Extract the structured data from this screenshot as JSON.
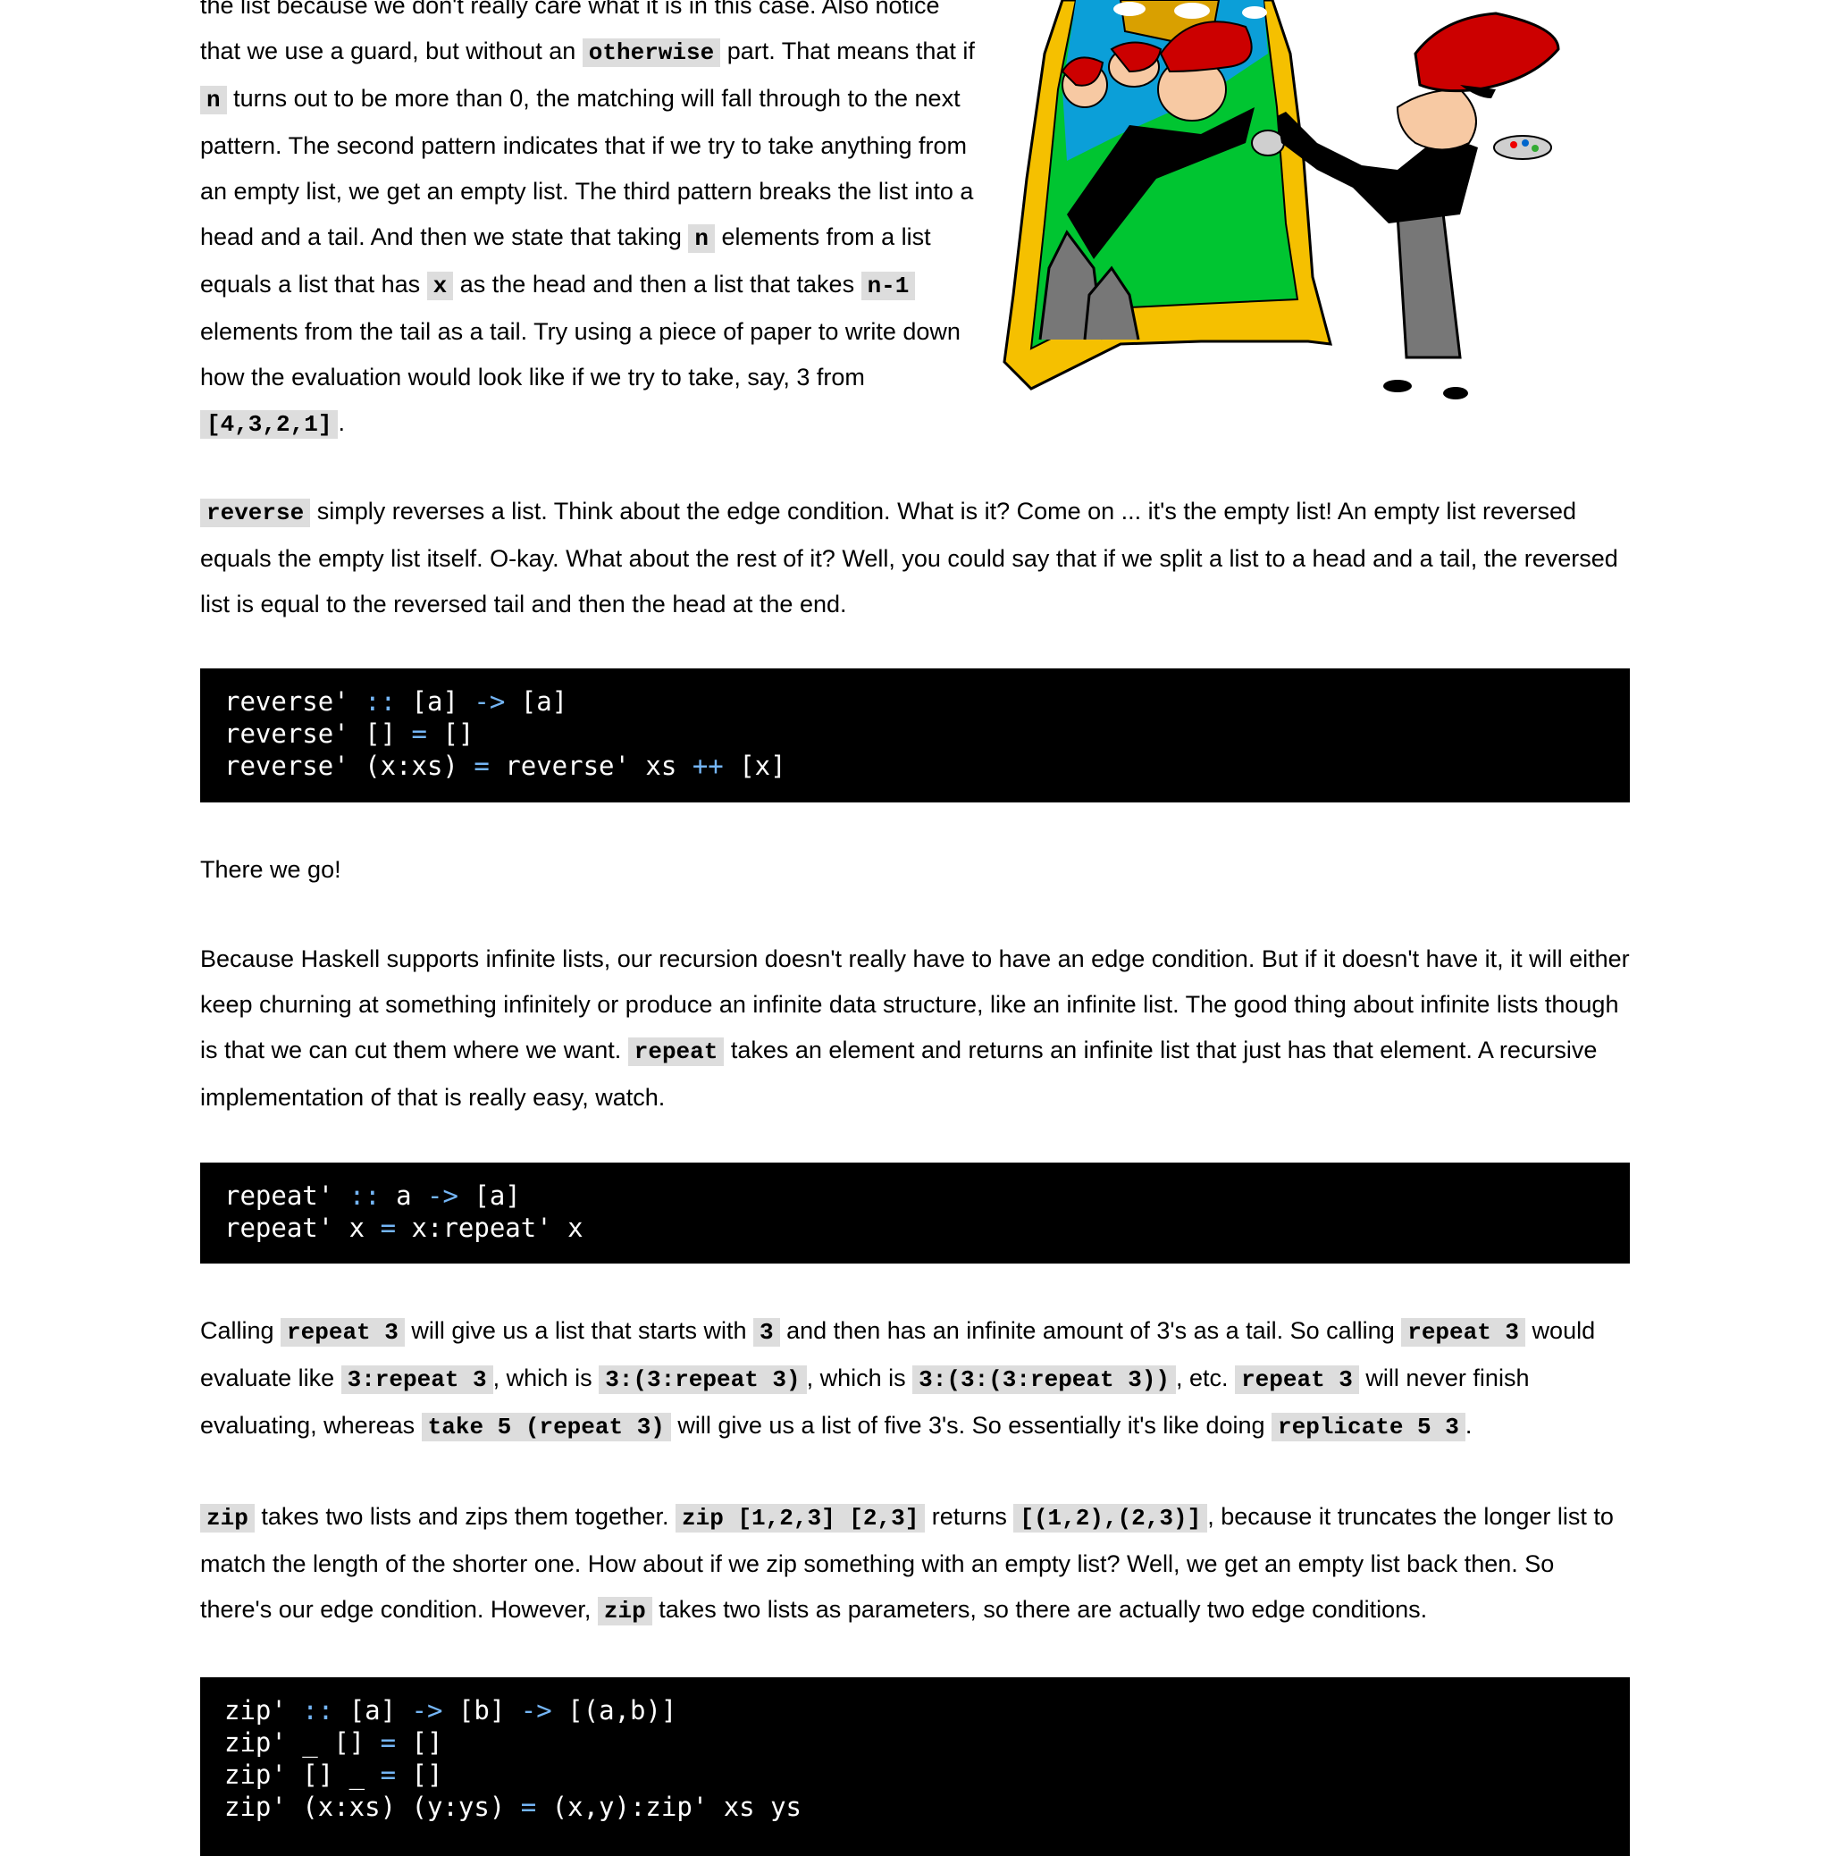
{
  "para_take": {
    "t1": "the list because we don't really care what it is in this case. Also notice that we use a guard, but without an ",
    "c1": "otherwise",
    "t2": " part. That means that if ",
    "c2": "n",
    "t3": " turns out to be more than 0, the matching will fall through to the next pattern. The second pattern indicates that if we try to take anything from an empty list, we get an empty list. The third pattern breaks the list into a head and a tail. And then we state that taking ",
    "c3": "n",
    "t4": " elements from a list equals a list that has ",
    "c4": "x",
    "t5": " as the head and then a list that takes ",
    "c5": "n-1",
    "t6": " elements from the tail as a tail. Try using a piece of paper to write down how the evaluation would look like if we try to take, say, 3 from ",
    "c6": "[4,3,2,1]",
    "t7": "."
  },
  "para_reverse": {
    "c1": "reverse",
    "t1": " simply reverses a list. Think about the edge condition. What is it? Come on ... it's the empty list! An empty list reversed equals the empty list itself. O-kay. What about the rest of it? Well, you could say that if we split a list to a head and a tail, the reversed list is equal to the reversed tail and then the head at the end."
  },
  "code_reverse": {
    "l1a": "reverse' ",
    "l1op1": "::",
    "l1b": " [a] ",
    "l1op2": "->",
    "l1c": " [a]",
    "l2a": "reverse' [] ",
    "l2op1": "=",
    "l2b": " []",
    "l3a": "reverse' (x:xs) ",
    "l3op1": "=",
    "l3b": " reverse' xs ",
    "l3op2": "++",
    "l3c": " [x]"
  },
  "para_therewego": "There we go!",
  "para_because": {
    "t1": "Because Haskell supports infinite lists, our recursion doesn't really have to have an edge condition. But if it doesn't have it, it will either keep churning at something infinitely or produce an infinite data structure, like an infinite list. The good thing about infinite lists though is that we can cut them where we want. ",
    "c1": "repeat",
    "t2": " takes an element and returns an infinite list that just has that element. A recursive implementation of that is really easy, watch."
  },
  "code_repeat": {
    "l1a": "repeat' ",
    "l1op1": "::",
    "l1b": " a ",
    "l1op2": "->",
    "l1c": " [a]",
    "l2a": "repeat' x ",
    "l2op1": "=",
    "l2b": " x:repeat' x"
  },
  "para_calling": {
    "t1": "Calling ",
    "c1": "repeat 3",
    "t2": " will give us a list that starts with ",
    "c2": "3",
    "t3": " and then has an infinite amount of 3's as a tail. So calling ",
    "c3": "repeat 3",
    "t4": " would evaluate like ",
    "c4": "3:repeat 3",
    "t5": ", which is ",
    "c5": "3:(3:repeat 3)",
    "t6": ", which is ",
    "c6": "3:(3:(3:repeat 3))",
    "t7": ", etc. ",
    "c7": "repeat 3",
    "t8": " will never finish evaluating, whereas ",
    "c8": "take 5 (repeat 3)",
    "t9": " will give us a list of five 3's. So essentially it's like doing ",
    "c9": "replicate 5 3",
    "t10": "."
  },
  "para_zip": {
    "c1": "zip",
    "t1": " takes two lists and zips them together. ",
    "c2": "zip [1,2,3] [2,3]",
    "t2": " returns ",
    "c3": "[(1,2),(2,3)]",
    "t3": ", because it truncates the longer list to match the length of the shorter one. How about if we zip something with an empty list? Well, we get an empty list back then. So there's our edge condition. However, ",
    "c4": "zip",
    "t4": " takes two lists as parameters, so there are actually two edge conditions."
  },
  "code_zip": {
    "l1a": "zip' ",
    "l1op1": "::",
    "l1b": " [a] ",
    "l1op2": "->",
    "l1c": " [b] ",
    "l1op3": "->",
    "l1d": " [(a,b)]",
    "l2a": "zip' _ [] ",
    "l2op1": "=",
    "l2b": " []",
    "l3a": "zip' [] _ ",
    "l3op1": "=",
    "l3b": " []",
    "l4a": "zip' (x:xs) (y:ys) ",
    "l4op1": "=",
    "l4b": " (x,y):zip' xs ys"
  },
  "colors": {
    "code_bg": "#000000",
    "code_operator": "#74b5f5",
    "inline_code_bg": "#dddddd",
    "beret_red": "#cc0000",
    "frame_yellow": "#f5c000",
    "canvas_green": "#00c531",
    "sky_blue": "#0b9fd8"
  }
}
